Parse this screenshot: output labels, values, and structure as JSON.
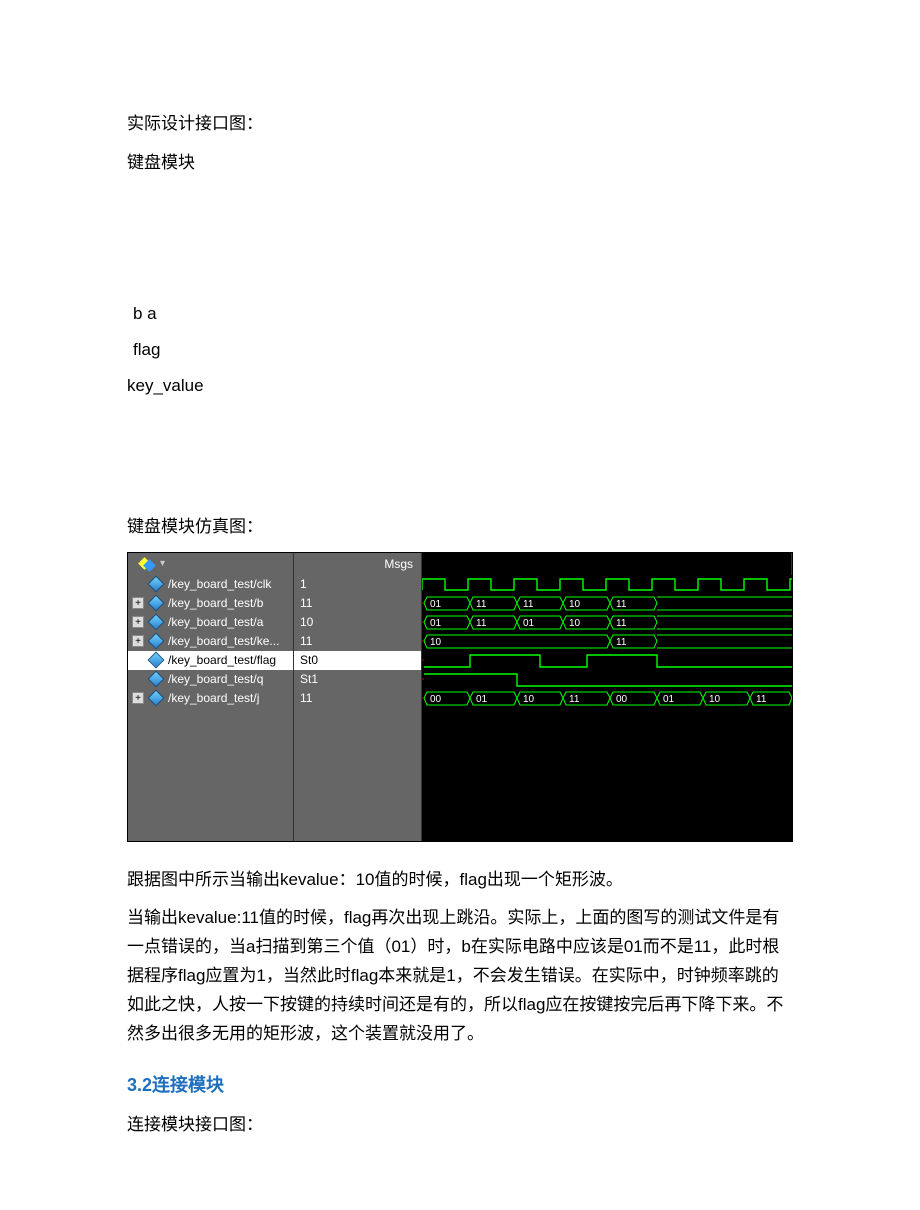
{
  "text": {
    "p1": "实际设计接口图：",
    "p2": "键盘模块",
    "l1": "b a",
    "l2": "flag",
    "l3": "key_value",
    "p3": "键盘模块仿真图：",
    "p4": "跟据图中所示当输出kevalue：10值的时候，flag出现一个矩形波。",
    "p5": "当输出kevalue:11值的时候，flag再次出现上跳沿。实际上，上面的图写的测试文件是有一点错误的，当a扫描到第三个值（01）时，b在实际电路中应该是01而不是11，此时根据程序flag应置为1，当然此时flag本来就是1，不会发生错误。在实际中，时钟频率跳的如此之快，人按一下按键的持续时间还是有的，所以flag应在按键按完后再下降下来。不然多出很多无用的矩形波，这个装置就没用了。",
    "h1": "3.2连接模块",
    "p6": "连接模块接口图："
  },
  "viewer": {
    "header_msgs": "Msgs",
    "signals": [
      {
        "expand": false,
        "name": "/key_board_test/clk",
        "msg": "1",
        "selected": false
      },
      {
        "expand": true,
        "name": "/key_board_test/b",
        "msg": "11",
        "selected": false
      },
      {
        "expand": true,
        "name": "/key_board_test/a",
        "msg": "10",
        "selected": false
      },
      {
        "expand": true,
        "name": "/key_board_test/ke...",
        "msg": "11",
        "selected": false
      },
      {
        "expand": false,
        "name": "/key_board_test/flag",
        "msg": "St0",
        "selected": true
      },
      {
        "expand": false,
        "name": "/key_board_test/q",
        "msg": "St1",
        "selected": false
      },
      {
        "expand": true,
        "name": "/key_board_test/j",
        "msg": "11",
        "selected": false
      }
    ],
    "bus_b": [
      "01",
      "11",
      "11",
      "10",
      "11"
    ],
    "bus_a": [
      "01",
      "11",
      "01",
      "10",
      "11"
    ],
    "bus_ke": [
      "10",
      "11"
    ],
    "bus_j": [
      "00",
      "01",
      "10",
      "11",
      "00",
      "01",
      "10",
      "11"
    ]
  }
}
